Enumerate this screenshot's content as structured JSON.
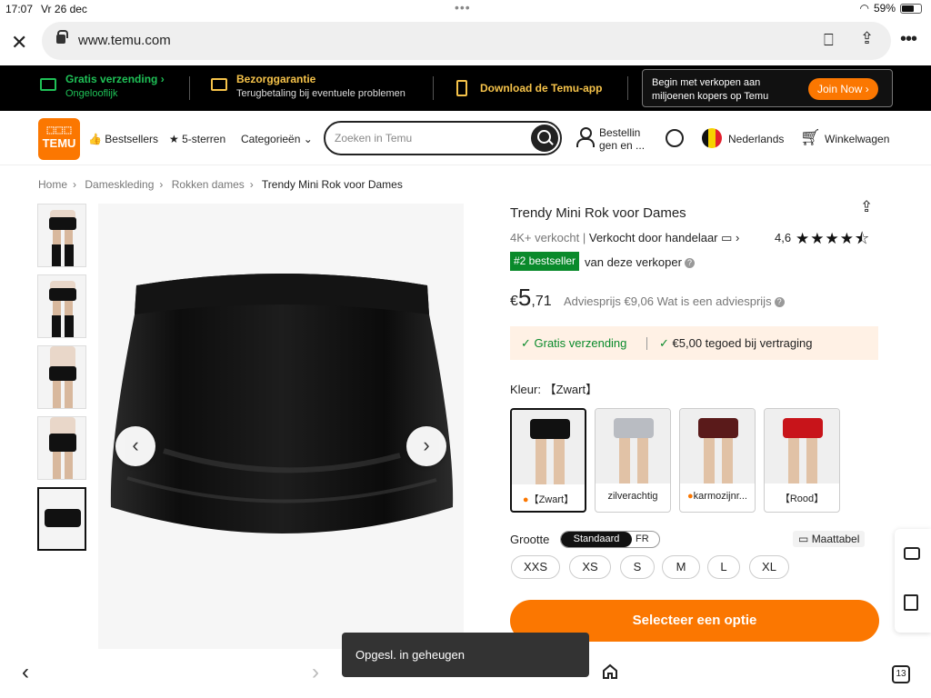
{
  "status": {
    "time": "17:07",
    "date": "Vr 26 dec",
    "battery": "59%",
    "battery_level": 0.59
  },
  "browser": {
    "url": "www.temu.com",
    "tab_count": "13"
  },
  "promo": {
    "free_shipping_title": "Gratis verzending",
    "free_shipping_sub": "Ongelooflijk",
    "guarantee_title": "Bezorggarantie",
    "guarantee_sub": "Terugbetaling bij eventuele problemen",
    "app_download": "Download de Temu-app",
    "sell_text": "Begin met verkopen aan miljoenen kopers op Temu",
    "join_button": "Join Now"
  },
  "nav": {
    "logo_text": "TEMU",
    "bestsellers": "Bestsellers",
    "five_stars": "5-sterren",
    "categories": "Categorieën",
    "search_placeholder": "Zoeken in Temu",
    "orders": "Bestellin gen en ...",
    "language": "Nederlands",
    "cart": "Winkelwagen"
  },
  "breadcrumb": [
    "Home",
    "Dameskleding",
    "Rokken dames",
    "Trendy Mini Rok voor Dames"
  ],
  "product": {
    "title": "Trendy Mini Rok voor Dames",
    "sold": "4K+ verkocht",
    "seller": "Verkocht door handelaar",
    "rating": "4,6",
    "stars": 4.6,
    "badge": "#2 bestseller",
    "badge_text": "van deze verkoper",
    "price_currency": "€",
    "price_int": "5",
    "price_dec": ",71",
    "advice_price": "Adviesprijs €9,06 Wat is een adviesprijs",
    "free_shipping": "Gratis verzending",
    "delay_credit": "€5,00 tegoed bij vertraging",
    "color_label": "Kleur: 【Zwart】",
    "colors": [
      {
        "label": "【Zwart】",
        "hex": "#111111",
        "selected": true
      },
      {
        "label": "zilverachtig",
        "hex": "#b9bcc2",
        "selected": false
      },
      {
        "label": "karmozijnr...",
        "hex": "#5a1a1a",
        "selected": false
      },
      {
        "label": "【Rood】",
        "hex": "#c8141a",
        "selected": false
      }
    ],
    "size_label": "Grootte",
    "size_system_active": "Standaard",
    "size_system_other": "FR",
    "size_chart": "Maattabel",
    "sizes": [
      "XXS",
      "XS",
      "S",
      "M",
      "L",
      "XL"
    ],
    "cta": "Selecteer een optie"
  },
  "toast": "Opgesl. in geheugen",
  "colors": {
    "accent": "#fb7701",
    "green": "#0a8a2b",
    "promo_green": "#1fc157",
    "promo_yellow": "#f6c34a"
  }
}
